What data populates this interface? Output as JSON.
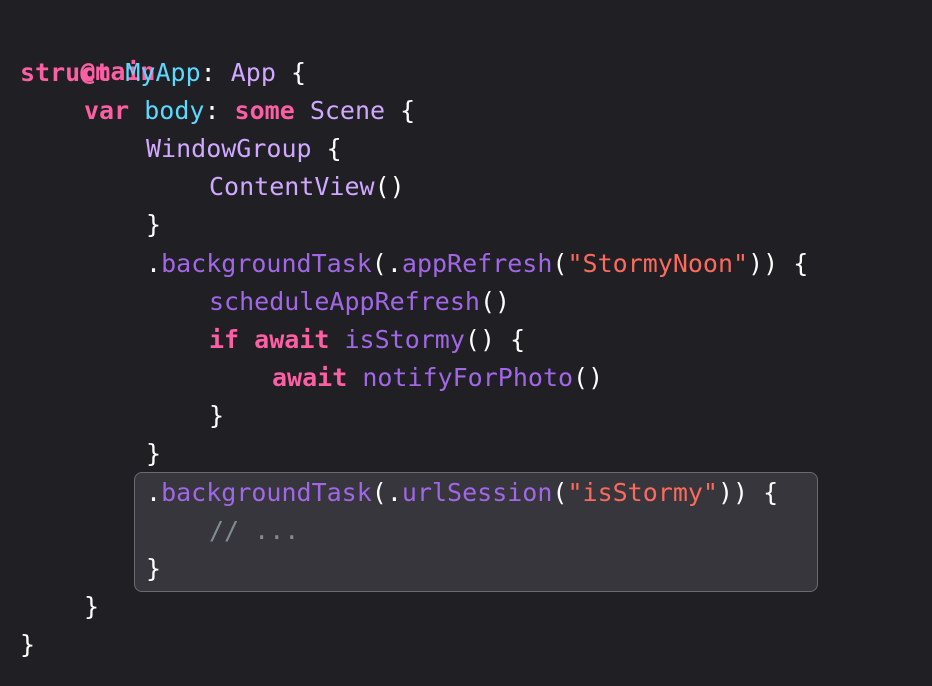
{
  "code": {
    "l1": {
      "attr": "@main"
    },
    "l2": {
      "kw": "struct",
      "name": "MyApp",
      "colon": ": ",
      "type": "App",
      "brace": " {"
    },
    "l3": {
      "kw": "var",
      "name": "body",
      "colon": ": ",
      "kw2": "some",
      "type": "Scene",
      "brace": " {"
    },
    "l4": {
      "type": "WindowGroup",
      "brace": " {"
    },
    "l5": {
      "type": "ContentView",
      "parens": "()"
    },
    "l6": {
      "brace": "}"
    },
    "l7": {
      "dot": ".",
      "fn": "backgroundTask",
      "open": "(.",
      "fn2": "appRefresh",
      "open2": "(",
      "str": "\"StormyNoon\"",
      "close": ")) {"
    },
    "l8": {
      "fn": "scheduleAppRefresh",
      "parens": "()"
    },
    "l9": {
      "kw": "if",
      "kw2": "await",
      "fn": "isStormy",
      "rest": "() {"
    },
    "l10": {
      "kw": "await",
      "fn": "notifyForPhoto",
      "parens": "()"
    },
    "l11": {
      "brace": "}"
    },
    "l12": {
      "brace": "}"
    },
    "l13": {
      "dot": ".",
      "fn": "backgroundTask",
      "open": "(.",
      "fn2": "urlSession",
      "open2": "(",
      "str": "\"isStormy\"",
      "close": ")) {"
    },
    "l14": {
      "comment": "// ..."
    },
    "l15": {
      "brace": "}"
    },
    "l16": {
      "brace": "}"
    },
    "l17": {
      "brace": "}"
    }
  },
  "colors": {
    "background": "#1f1f24",
    "keyword": "#fc5fa3",
    "declaration": "#5dd8ff",
    "type": "#d0a8ff",
    "function": "#a167e6",
    "string": "#fc6a5d",
    "comment": "#7f8c98",
    "highlight": "#36363c"
  }
}
